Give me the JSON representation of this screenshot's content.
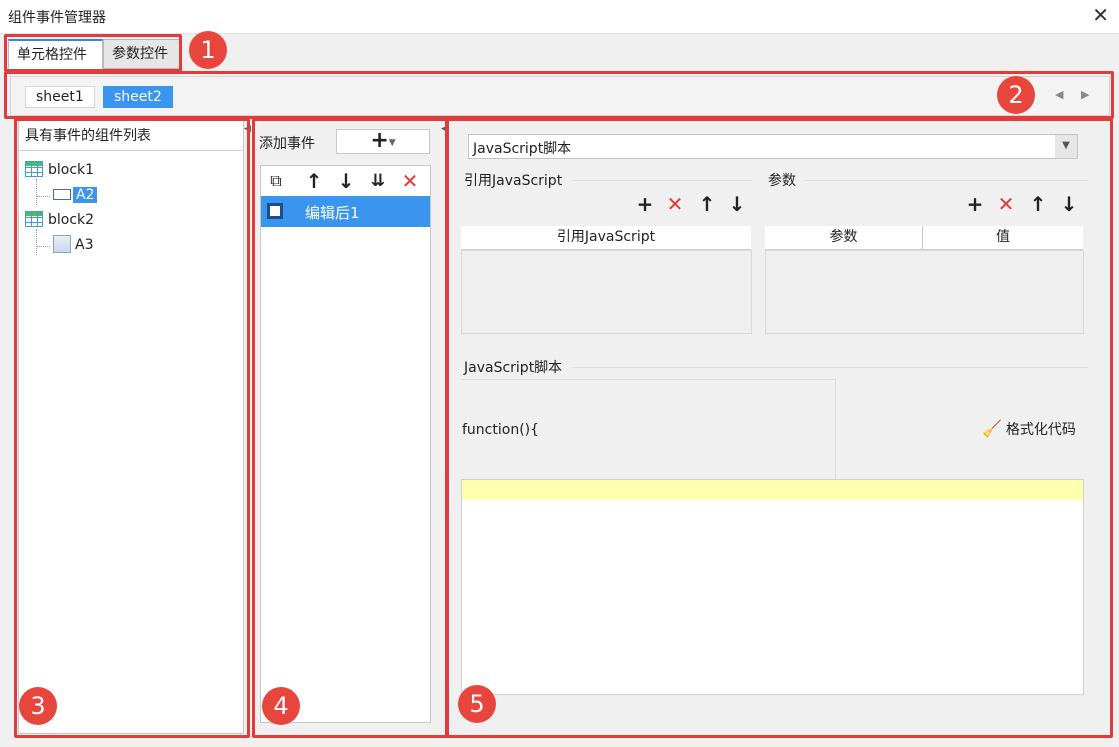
{
  "window": {
    "title": "组件事件管理器",
    "close": "✕"
  },
  "tabs": [
    {
      "label": "单元格控件",
      "active": true
    },
    {
      "label": "参数控件",
      "active": false
    }
  ],
  "sheets": [
    {
      "label": "sheet1",
      "active": false
    },
    {
      "label": "sheet2",
      "active": true
    }
  ],
  "markers": [
    "1",
    "2",
    "3",
    "4",
    "5"
  ],
  "component_list": {
    "title": "具有事件的组件列表",
    "items": [
      {
        "label": "block1",
        "icon": "table-grid-icon",
        "level": 0
      },
      {
        "label": "A2",
        "icon": "textbox-widget-icon",
        "level": 1,
        "selected": true
      },
      {
        "label": "block2",
        "icon": "table-grid-icon",
        "level": 0
      },
      {
        "label": "A3",
        "icon": "widget-box-icon",
        "level": 1,
        "selected": false
      }
    ]
  },
  "events": {
    "add_label": "添加事件",
    "add_button": "+",
    "items": [
      {
        "label": "编辑后1",
        "selected": true
      }
    ]
  },
  "script_editor": {
    "type_select": "JavaScript脚本",
    "ref_js_section": "引用JavaScript",
    "ref_js_column": "引用JavaScript",
    "params_section": "参数",
    "params_columns": [
      "参数",
      "值"
    ],
    "js_section": "JavaScript脚本",
    "function_header": "function(){",
    "format_button": "格式化代码"
  },
  "colors": {
    "accent": "#3a95ef",
    "annotation_red": "#e03c3c",
    "delete_red": "#e53935",
    "highlight_line": "#ffffb0"
  }
}
